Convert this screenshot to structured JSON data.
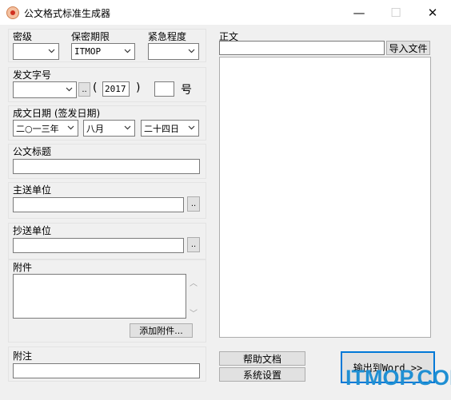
{
  "window": {
    "title": "公文格式标准生成器",
    "minimize_glyph": "—",
    "maximize_glyph": "☐",
    "close_glyph": "✕"
  },
  "secrecy": {
    "label": "密级",
    "value": ""
  },
  "security_period": {
    "label": "保密期限",
    "value": "ITMOP"
  },
  "urgency": {
    "label": "紧急程度",
    "value": ""
  },
  "doc_number": {
    "label": "发文字号",
    "prefix_value": "",
    "browse_label": "..",
    "paren_open": "(",
    "year": "2017",
    "paren_close": ")",
    "number_value": "",
    "hao": "号"
  },
  "date": {
    "label": "成文日期 (签发日期)",
    "year": "二○一三年",
    "month": "八月",
    "day": "二十四日"
  },
  "doc_title": {
    "label": "公文标题",
    "value": ""
  },
  "main_recipient": {
    "label": "主送单位",
    "value": "",
    "browse_label": ".."
  },
  "cc": {
    "label": "抄送单位",
    "value": "",
    "browse_label": ".."
  },
  "attachment": {
    "label": "附件",
    "value": "",
    "add_label": "添加附件..."
  },
  "note": {
    "label": "附注",
    "value": ""
  },
  "body": {
    "label": "正文",
    "path_value": "",
    "import_label": "导入文件",
    "content": ""
  },
  "buttons": {
    "help": "帮助文档",
    "settings": "系统设置",
    "export": "输出到Word >>"
  },
  "watermark": "ITMOP.COM",
  "icons": {
    "app": "app-logo-icon",
    "dropdown": "chevron-down-icon",
    "scroll_up": "scroll-up-icon",
    "scroll_down": "scroll-down-icon"
  }
}
